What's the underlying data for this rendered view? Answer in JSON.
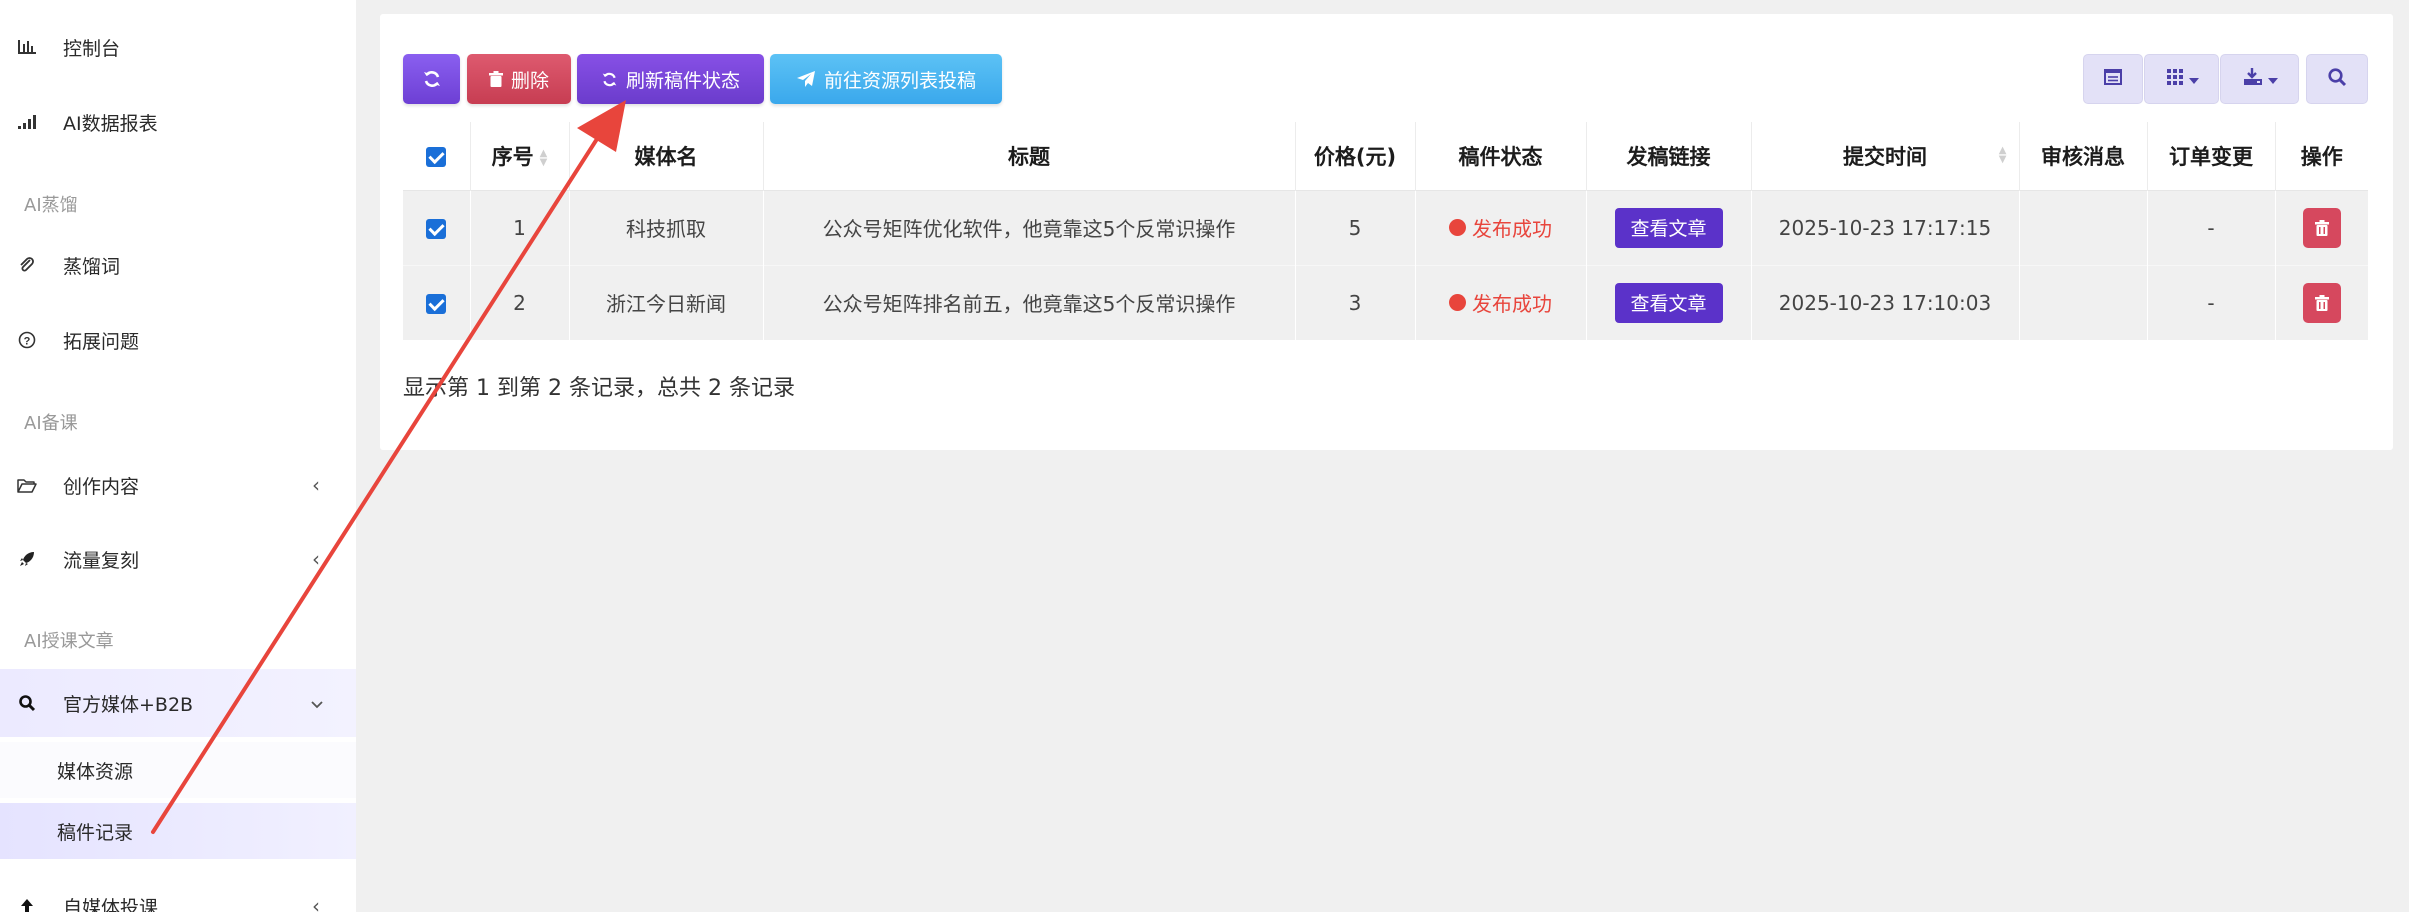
{
  "sidebar": {
    "items": [
      {
        "label": "控制台",
        "icon": "bar-chart-icon"
      },
      {
        "label": "AI数据报表",
        "icon": "signal-bars-icon"
      }
    ],
    "section_distill": "AI蒸馏",
    "distill_items": [
      {
        "label": "蒸馏词",
        "icon": "paperclip-icon"
      },
      {
        "label": "拓展问题",
        "icon": "question-circle-icon"
      }
    ],
    "section_prepare": "AI备课",
    "prepare_items": [
      {
        "label": "创作内容",
        "icon": "folder-open-icon",
        "chevron": "‹"
      },
      {
        "label": "流量复刻",
        "icon": "rocket-icon",
        "chevron": "‹"
      }
    ],
    "section_article": "AI授课文章",
    "official_media": {
      "label": "官方媒体+B2B",
      "icon": "search-icon",
      "chevron": "⌄"
    },
    "sub_items": [
      {
        "label": "媒体资源"
      },
      {
        "label": "稿件记录"
      }
    ],
    "self_media": {
      "label": "自媒体投课",
      "icon": "upload-arrow-icon",
      "chevron": "‹"
    }
  },
  "toolbar": {
    "delete_label": "删除",
    "refresh_status_label": "刷新稿件状态",
    "goto_resource_label": "前往资源列表投稿"
  },
  "table": {
    "headers": [
      "序号",
      "媒体名",
      "标题",
      "价格(元)",
      "稿件状态",
      "发稿链接",
      "提交时间",
      "审核消息",
      "订单变更",
      "操作"
    ],
    "rows": [
      {
        "index": "1",
        "media": "科技抓取",
        "title": "公众号矩阵优化软件，他竟靠这5个反常识操作",
        "price": "5",
        "status": "发布成功",
        "link": "查看文章",
        "time": "2025-10-23 17:17:15",
        "review": "",
        "order_change": "-"
      },
      {
        "index": "2",
        "media": "浙江今日新闻",
        "title": "公众号矩阵排名前五，他竟靠这5个反常识操作",
        "price": "3",
        "status": "发布成功",
        "link": "查看文章",
        "time": "2025-10-23 17:10:03",
        "review": "",
        "order_change": "-"
      }
    ]
  },
  "pagination_text": "显示第 1 到第 2 条记录，总共 2 条记录",
  "colors": {
    "accent_purple": "#7b4fe0",
    "delete_red": "#d6485e",
    "refresh_violet": "#7a45d6",
    "goto_blue": "#45b3f0",
    "status_red": "#e8453c",
    "arrow_red": "#e8453c"
  }
}
